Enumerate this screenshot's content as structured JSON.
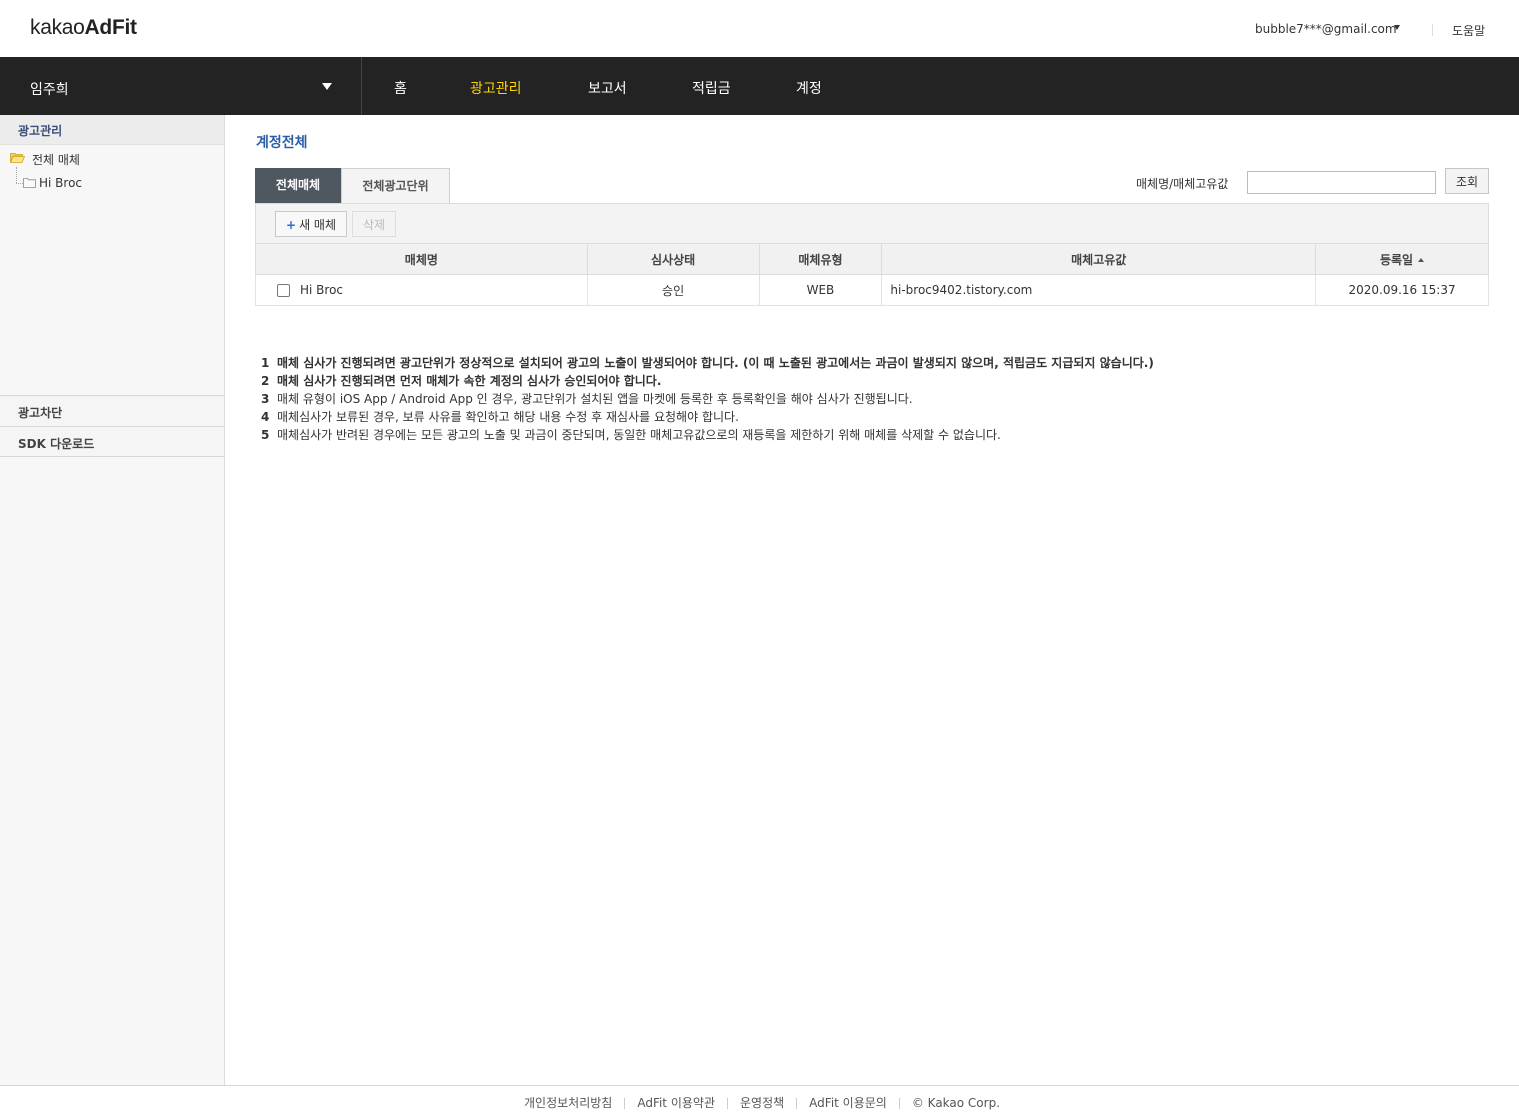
{
  "header": {
    "logo_prefix": "kakao",
    "logo_bold": "AdFit",
    "account_email": "bubble7***@gmail.com",
    "help_label": "도움말"
  },
  "nav": {
    "account_name": "임주희",
    "items": [
      {
        "label": "홈",
        "active": false
      },
      {
        "label": "광고관리",
        "active": true
      },
      {
        "label": "보고서",
        "active": false
      },
      {
        "label": "적립금",
        "active": false
      },
      {
        "label": "계정",
        "active": false
      }
    ]
  },
  "sidebar": {
    "section_active": "광고관리",
    "tree_root": "전체 매체",
    "tree_child": "Hi Broc",
    "section_block": "광고차단",
    "section_sdk": "SDK 다운로드"
  },
  "main": {
    "page_title": "계정전체",
    "tabs": [
      {
        "label": "전체매체",
        "active": true
      },
      {
        "label": "전체광고단위",
        "active": false
      }
    ],
    "search": {
      "label": "매체명/매체고유값",
      "value": "",
      "button_label": "조회"
    },
    "toolbar": {
      "new_label": "새 매체",
      "delete_label": "삭제"
    },
    "table": {
      "columns": [
        "매체명",
        "심사상태",
        "매체유형",
        "매체고유값",
        "등록일"
      ],
      "rows": [
        {
          "name": "Hi Broc",
          "status": "승인",
          "type": "WEB",
          "unique_value": "hi-broc9402.tistory.com",
          "registered": "2020.09.16 15:37"
        }
      ]
    },
    "notes": [
      {
        "num": "1",
        "text": "매체 심사가 진행되려면 광고단위가 정상적으로 설치되어 광고의 노출이 발생되어야 합니다. (이 때 노출된 광고에서는 과금이 발생되지 않으며, 적립금도 지급되지 않습니다.)"
      },
      {
        "num": "2",
        "text": "매체 심사가 진행되려면 먼저 매체가 속한 계정의 심사가 승인되어야 합니다."
      },
      {
        "num": "3",
        "text": "매체 유형이 iOS App / Android App 인 경우, 광고단위가 설치된 앱을 마켓에 등록한 후 등록확인을 해야 심사가 진행됩니다."
      },
      {
        "num": "4",
        "text": "매체심사가 보류된 경우, 보류 사유를 확인하고 해당 내용 수정 후 재심사를 요청해야 합니다."
      },
      {
        "num": "5",
        "text": "매체심사가 반려된 경우에는 모든 광고의 노출 및 과금이 중단되며, 동일한 매체고유값으로의 재등록을 제한하기 위해 매체를 삭제할 수 없습니다."
      }
    ]
  },
  "footer": {
    "links": [
      "개인정보처리방침",
      "AdFit 이용약관",
      "운영정책",
      "AdFit 이용문의",
      "© Kakao Corp."
    ]
  },
  "colors": {
    "nav_bg": "#232323",
    "nav_active": "#ffd400",
    "title_blue": "#2a5fa8",
    "tab_active_bg": "#4f5760"
  }
}
